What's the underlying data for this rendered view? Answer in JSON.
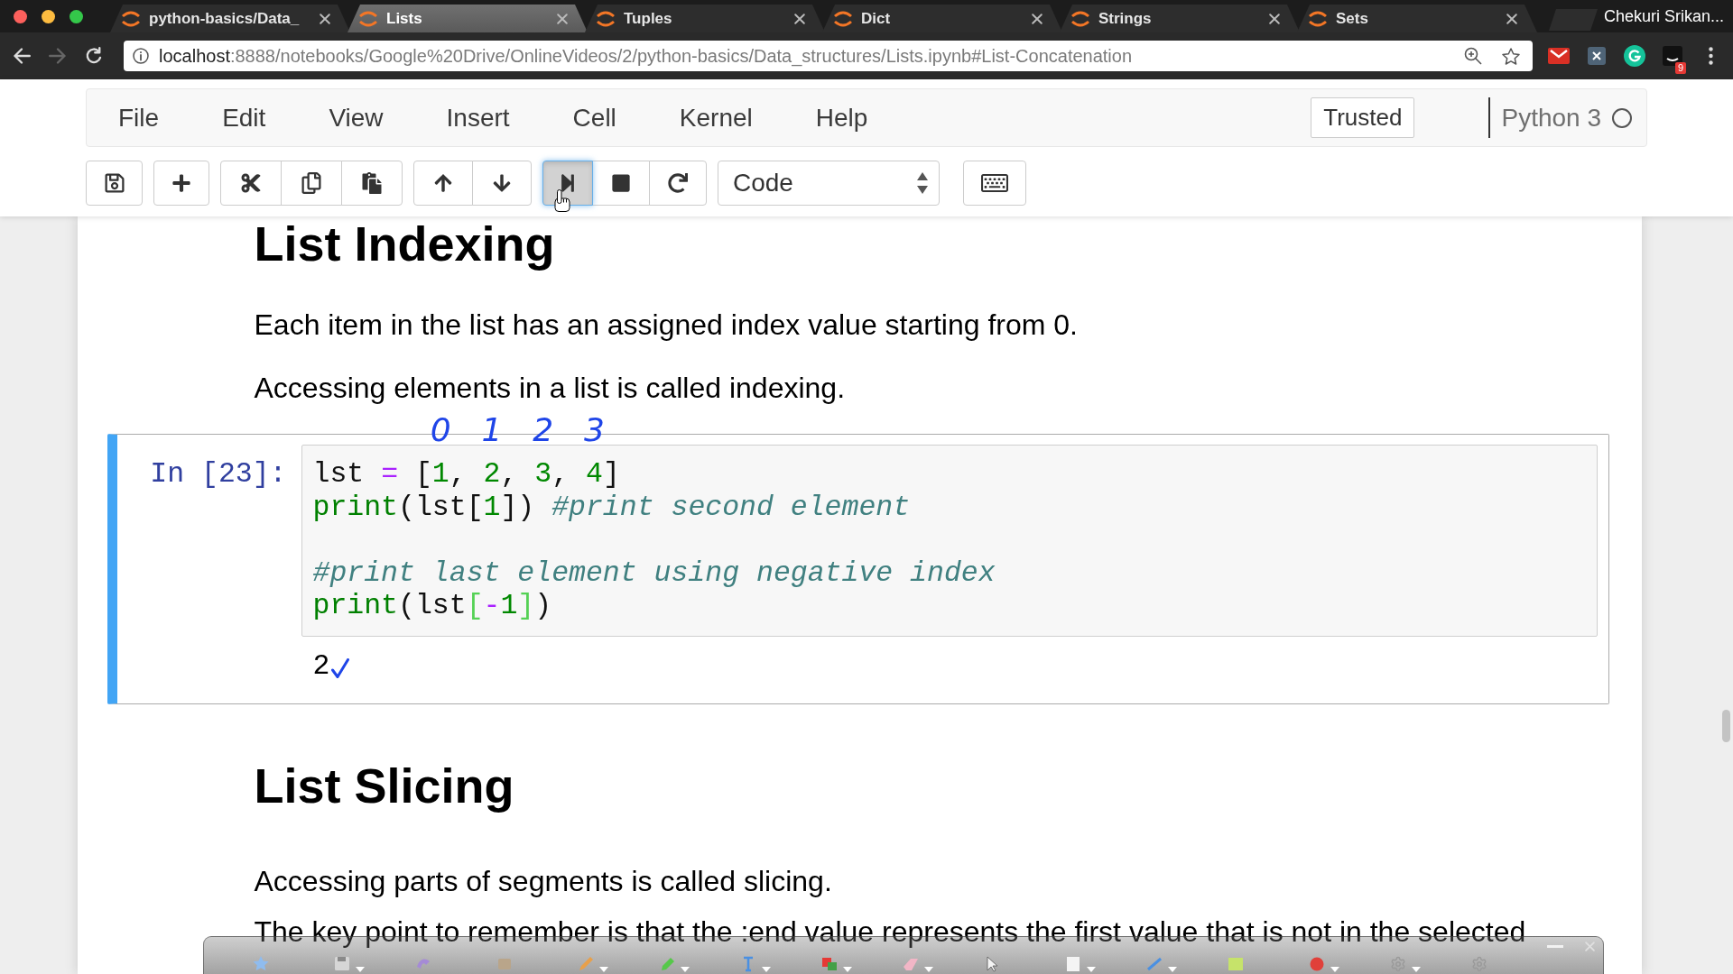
{
  "browser": {
    "tabs": [
      {
        "title": "python-basics/Data_",
        "selected": false
      },
      {
        "title": "Lists",
        "selected": true
      },
      {
        "title": "Tuples",
        "selected": false
      },
      {
        "title": "Dict",
        "selected": false
      },
      {
        "title": "Strings",
        "selected": false
      },
      {
        "title": "Sets",
        "selected": false
      }
    ],
    "profile": "Chekuri Srikan...",
    "nav": [
      {
        "kind": "back",
        "enabled": true
      },
      {
        "kind": "forward",
        "enabled": false
      },
      {
        "kind": "reload",
        "enabled": true
      }
    ],
    "url": {
      "host": "localhost",
      "rest": ":8888/notebooks/Google%20Drive/OnlineVideos/2/python-basics/Data_structures/Lists.ipynb#List-Concatenation"
    },
    "extension_badge": "9"
  },
  "menubar": {
    "items": [
      "File",
      "Edit",
      "View",
      "Insert",
      "Cell",
      "Kernel",
      "Help"
    ],
    "trusted": "Trusted",
    "kernel": {
      "name": "Python 3",
      "busy": false
    }
  },
  "toolbar": {
    "groups": [
      [
        {
          "kind": "save",
          "pressed": false
        }
      ],
      [
        {
          "kind": "add",
          "pressed": false
        }
      ],
      [
        {
          "kind": "cut",
          "pressed": false
        },
        {
          "kind": "copy",
          "pressed": false
        },
        {
          "kind": "paste",
          "pressed": false
        }
      ],
      [
        {
          "kind": "up",
          "pressed": false
        },
        {
          "kind": "down",
          "pressed": false
        }
      ],
      [
        {
          "kind": "run",
          "pressed": true
        },
        {
          "kind": "stop",
          "pressed": false
        },
        {
          "kind": "restart",
          "pressed": false
        }
      ],
      [
        {
          "kind": "select",
          "value": "Code"
        }
      ],
      [
        {
          "kind": "keyboard",
          "pressed": false
        }
      ]
    ]
  },
  "notebook": {
    "cells": [
      {
        "kind": "heading",
        "text": "List Indexing"
      },
      {
        "kind": "paragraph",
        "text": "Each item in the list has an assigned index value starting from 0."
      },
      {
        "kind": "paragraph",
        "text": "Accessing elements in a list is called indexing."
      },
      {
        "kind": "code",
        "selected": true,
        "prompt": "In [23]:",
        "pen_marks": [
          "0",
          "1",
          "2",
          "3"
        ],
        "lines": [
          {
            "kind": "code",
            "tokens": [
              {
                "text": "lst ",
                "kind": "plain"
              },
              {
                "text": "=",
                "kind": "operator"
              },
              {
                "text": " [",
                "kind": "plain"
              },
              {
                "text": "1",
                "kind": "number"
              },
              {
                "text": ", ",
                "kind": "plain"
              },
              {
                "text": "2",
                "kind": "number"
              },
              {
                "text": ", ",
                "kind": "plain"
              },
              {
                "text": "3",
                "kind": "number"
              },
              {
                "text": ", ",
                "kind": "plain"
              },
              {
                "text": "4",
                "kind": "number"
              },
              {
                "text": "]",
                "kind": "plain"
              }
            ]
          },
          {
            "kind": "code",
            "tokens": [
              {
                "text": "print",
                "kind": "builtin"
              },
              {
                "text": "(lst[",
                "kind": "plain"
              },
              {
                "text": "1",
                "kind": "number"
              },
              {
                "text": "]) ",
                "kind": "plain"
              },
              {
                "text": "#print second element",
                "kind": "comment"
              }
            ]
          },
          {
            "kind": "blank"
          },
          {
            "kind": "code",
            "tokens": [
              {
                "text": "#print last element using negative index",
                "kind": "comment"
              }
            ]
          },
          {
            "kind": "code",
            "tokens": [
              {
                "text": "print",
                "kind": "builtin"
              },
              {
                "text": "(lst",
                "kind": "plain"
              },
              {
                "text": "[",
                "kind": "match"
              },
              {
                "text": "-",
                "kind": "operator"
              },
              {
                "text": "1",
                "kind": "number"
              },
              {
                "text": "]",
                "kind": "match"
              },
              {
                "text": ")",
                "kind": "plain"
              }
            ]
          }
        ],
        "output": "2"
      },
      {
        "kind": "heading",
        "text": "List Slicing"
      },
      {
        "kind": "paragraph",
        "text": "Accessing parts of segments is called slicing."
      },
      {
        "kind": "paragraph",
        "text": "The key point to remember is that the :end value represents the first value that is not in the selected"
      }
    ]
  }
}
